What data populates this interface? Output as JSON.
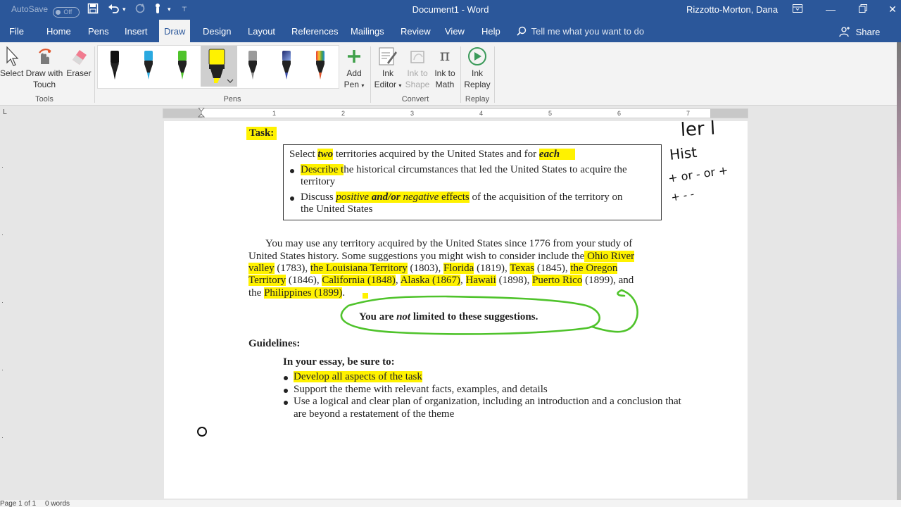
{
  "titlebar": {
    "autosave_label": "AutoSave",
    "autosave_state": "Off",
    "document_title": "Document1 - Word",
    "user_name": "Rizzotto-Morton, Dana"
  },
  "tabs": {
    "file": "File",
    "home": "Home",
    "pens": "Pens",
    "insert": "Insert",
    "draw": "Draw",
    "design": "Design",
    "layout": "Layout",
    "references": "References",
    "mailings": "Mailings",
    "review": "Review",
    "view": "View",
    "help": "Help",
    "active": "Draw"
  },
  "tell_me": {
    "placeholder": "Tell me what you want to do"
  },
  "share": {
    "label": "Share"
  },
  "ribbon": {
    "tools": {
      "group_label": "Tools",
      "select": "Select",
      "draw_with_touch_1": "Draw with",
      "draw_with_touch_2": "Touch",
      "eraser": "Eraser"
    },
    "pens": {
      "group_label": "Pens",
      "items": [
        {
          "color": "#111111",
          "name": "black-pen"
        },
        {
          "color": "#2aa9e0",
          "name": "blue-pen"
        },
        {
          "color": "#4fc32b",
          "name": "green-pen"
        },
        {
          "color": "#fff200",
          "name": "yellow-highlighter",
          "selected": true
        },
        {
          "color": "#9a9a9a",
          "name": "galaxy-pen"
        },
        {
          "color": "#3b4da8",
          "name": "gradient-pen"
        },
        {
          "color": "#e0562d",
          "name": "rainbow-pen"
        }
      ]
    },
    "add_pen": {
      "line1": "Add",
      "line2": "Pen"
    },
    "convert": {
      "group_label": "Convert",
      "ink_editor_1": "Ink",
      "ink_editor_2": "Editor",
      "ink_to_shape_1": "Ink to",
      "ink_to_shape_2": "Shape",
      "ink_to_math_1": "Ink to",
      "ink_to_math_2": "Math"
    },
    "replay": {
      "group_label": "Replay",
      "ink_replay_1": "Ink",
      "ink_replay_2": "Replay"
    }
  },
  "ruler": {
    "numbers": [
      "1",
      "2",
      "3",
      "4",
      "5",
      "6",
      "7"
    ]
  },
  "document": {
    "task_heading": "Task:",
    "task_line1": {
      "a": "Select ",
      "b": "two",
      "c": " territories acquired by the United States and for ",
      "d": "each"
    },
    "bullet1": {
      "a": "Describe t",
      "b": "he historical circumstances that led the United States to acquire the",
      "c": "territory"
    },
    "bullet2": {
      "a": "Discuss ",
      "b": "positive",
      "c": " and/or ",
      "d": "negative",
      "e": " effects",
      "f": " of the acquisition of the territory on",
      "g": "the United States"
    },
    "para": {
      "l1": "You may use any territory acquired by the United States since 1776 from your study of",
      "l2a": "United States history. Some suggestions you might wish to consider include the",
      "l2b": " Ohio River",
      "l3a": "valley",
      "l3b": " (1783), ",
      "l3c": "the Louisiana Territory",
      "l3d": " (1803), ",
      "l3e": "Florida",
      "l3f": " (1819), ",
      "l3g": "Texas",
      "l3h": " (1845), ",
      "l3i": "the Oregon",
      "l4a": "Territory",
      "l4b": " (1846), ",
      "l4c": "California (1848)",
      "l4d": ", ",
      "l4e": "Alaska (1867)",
      "l4f": ", ",
      "l4g": "Hawaii",
      "l4h": " (1898), ",
      "l4i": "Puerto Rico",
      "l4j": " (1899), and",
      "l5a": "the ",
      "l5b": "Philippines (1899)",
      "l5c": "."
    },
    "callout": {
      "a": "You are ",
      "b": "not",
      "c": " limited to these suggestions."
    },
    "guidelines": "Guidelines:",
    "essay_heading": "In your essay, be sure to:",
    "g_bullet1": "Develop all aspects of the task",
    "g_bullet2": "Support the theme with relevant facts, examples, and details",
    "g_bullet3a": "Use a logical and clear plan of organization, including an introduction and a conclusion that",
    "g_bullet3b": "are beyond a restatement of the theme"
  },
  "handwriting": {
    "line1": "ler l",
    "line2": "Hist",
    "line3": "+ or - or +",
    "line4": "+ - -"
  },
  "status": {
    "page": "Page 1 of 1",
    "words": "0 words"
  }
}
